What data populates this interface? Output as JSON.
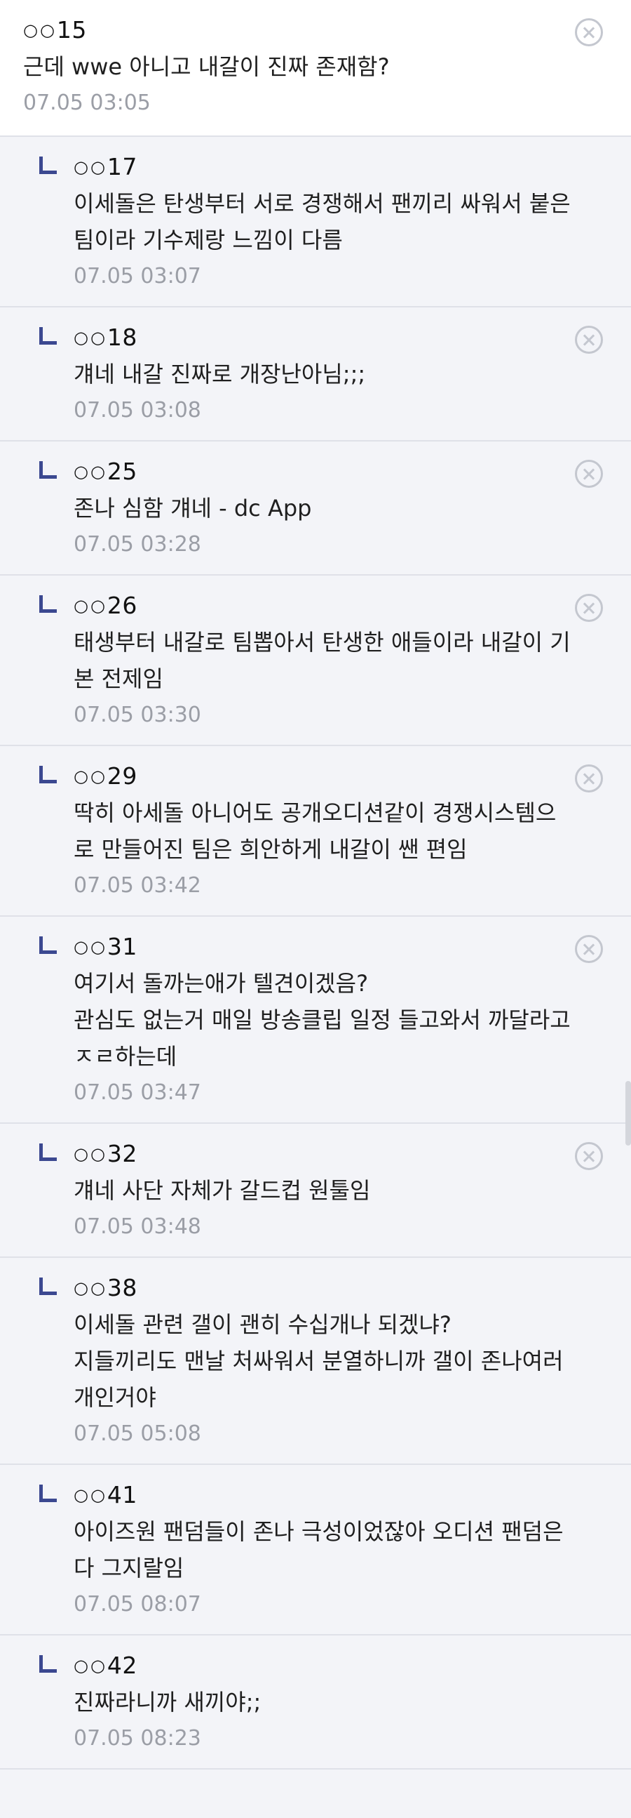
{
  "comments": [
    {
      "type": "top",
      "author": "15",
      "lines": [
        "근데 wwe 아니고 내갈이 진짜 존재함?"
      ],
      "date": "07.05 03:05",
      "delete": true
    },
    {
      "type": "reply",
      "author": "17",
      "lines": [
        "이세돌은 탄생부터 서로 경쟁해서 팬끼리 싸워서 붙은",
        "팀이라 기수제랑 느낌이 다름"
      ],
      "date": "07.05 03:07",
      "delete": false
    },
    {
      "type": "reply",
      "author": "18",
      "lines": [
        "걔네 내갈 진짜로 개장난아님;;;"
      ],
      "date": "07.05 03:08",
      "delete": true
    },
    {
      "type": "reply",
      "author": "25",
      "lines": [
        "존나 심함 걔네 - dc App"
      ],
      "date": "07.05 03:28",
      "delete": true
    },
    {
      "type": "reply",
      "author": "26",
      "lines": [
        "태생부터 내갈로 팀뽑아서 탄생한 애들이라 내갈이 기",
        "본 전제임"
      ],
      "date": "07.05 03:30",
      "delete": true
    },
    {
      "type": "reply",
      "author": "29",
      "lines": [
        "딱히 아세돌 아니어도 공개오디션같이 경쟁시스템으",
        "로 만들어진 팀은 희안하게 내갈이 쌘 편임"
      ],
      "date": "07.05 03:42",
      "delete": true
    },
    {
      "type": "reply",
      "author": "31",
      "lines": [
        "여기서 돌까는애가 텔견이겠음?",
        "관심도 없는거 매일 방송클립 일정 들고와서 까달라고",
        "ㅈㄹ하는데"
      ],
      "date": "07.05 03:47",
      "delete": true
    },
    {
      "type": "reply",
      "author": "32",
      "lines": [
        "걔네 사단 자체가 갈드컵 원툴임"
      ],
      "date": "07.05 03:48",
      "delete": true
    },
    {
      "type": "reply",
      "author": "38",
      "lines": [
        "이세돌 관련 갤이 괜히 수십개나 되겠냐?",
        "지들끼리도 맨날 처싸워서 분열하니까 갤이 존나여러",
        "개인거야"
      ],
      "date": "07.05 05:08",
      "delete": false
    },
    {
      "type": "reply",
      "author": "41",
      "lines": [
        "아이즈원 팬덤들이 존나 극성이었잖아 오디션 팬덤은",
        "다 그지랄임"
      ],
      "date": "07.05 08:07",
      "delete": false
    },
    {
      "type": "reply",
      "author": "42",
      "lines": [
        "진짜라니까 새끼야;;"
      ],
      "date": "07.05 08:23",
      "delete": false
    }
  ]
}
